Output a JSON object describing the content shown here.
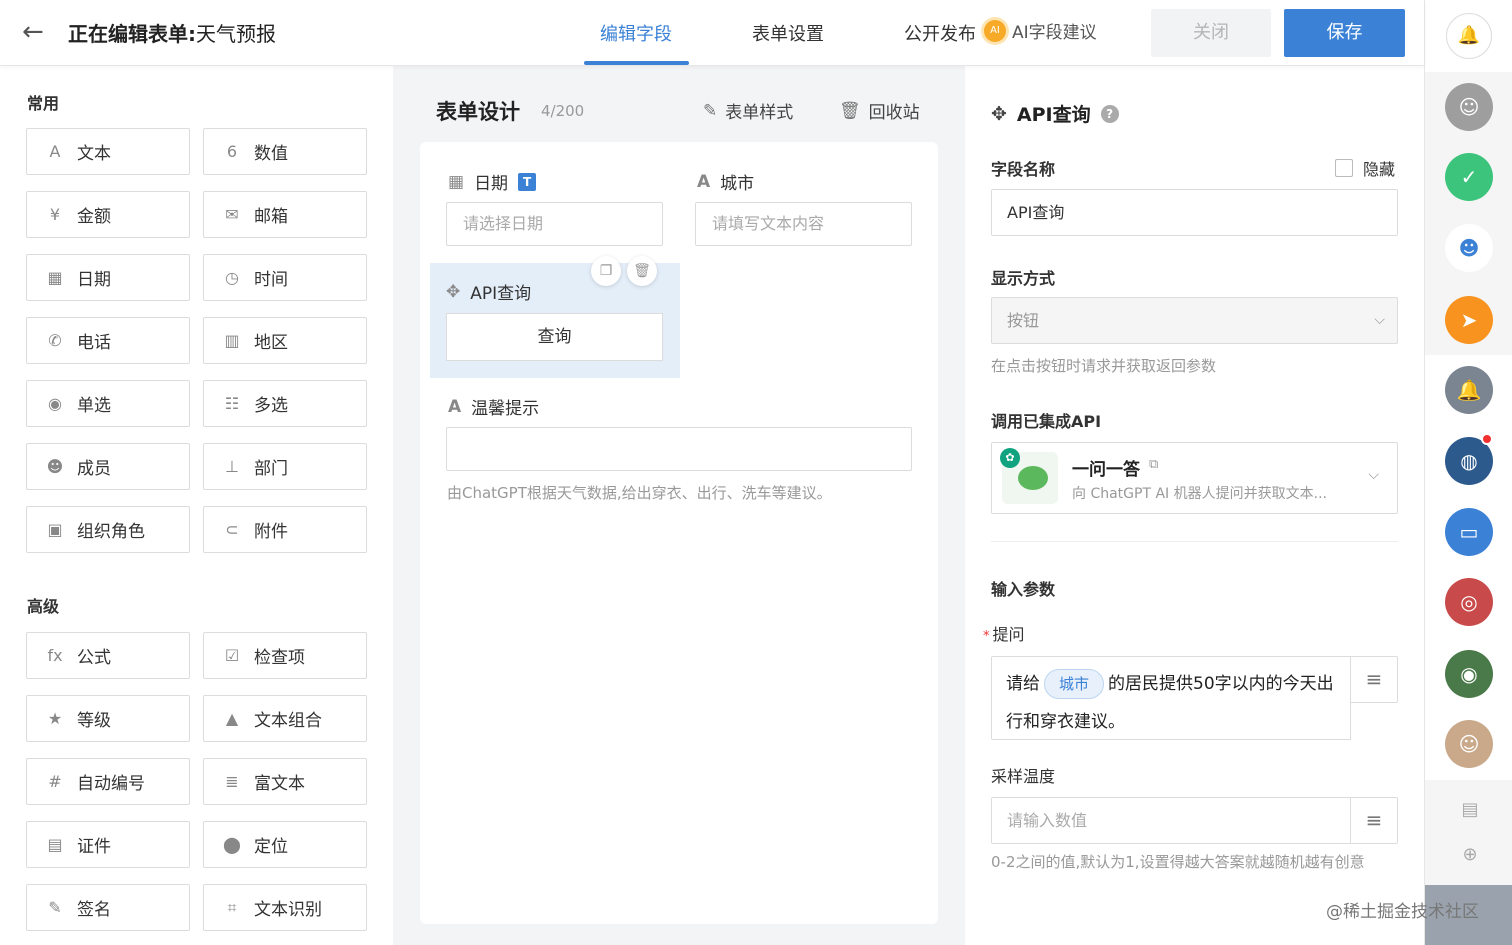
{
  "header": {
    "back_icon": "arrow-left-icon",
    "title_prefix": "正在编辑表单:",
    "title_name": "天气预报",
    "tabs": [
      {
        "label": "编辑字段",
        "active": true
      },
      {
        "label": "表单设置",
        "active": false
      },
      {
        "label": "公开发布",
        "active": false
      }
    ],
    "ai_badge": "AI",
    "ai_suggest": "AI字段建议",
    "close_label": "关闭",
    "save_label": "保存",
    "accent_color": "#3b82d6"
  },
  "palette": {
    "common_title": "常用",
    "common": [
      {
        "label": "文本",
        "icon": "A"
      },
      {
        "label": "数值",
        "icon": "6"
      },
      {
        "label": "金额",
        "icon": "¥"
      },
      {
        "label": "邮箱",
        "icon": "✉"
      },
      {
        "label": "日期",
        "icon": "▦"
      },
      {
        "label": "时间",
        "icon": "◷"
      },
      {
        "label": "电话",
        "icon": "✆"
      },
      {
        "label": "地区",
        "icon": "▥"
      },
      {
        "label": "单选",
        "icon": "◉"
      },
      {
        "label": "多选",
        "icon": "☷"
      },
      {
        "label": "成员",
        "icon": "☻"
      },
      {
        "label": "部门",
        "icon": "⊥"
      },
      {
        "label": "组织角色",
        "icon": "▣"
      },
      {
        "label": "附件",
        "icon": "⊂"
      }
    ],
    "advanced_title": "高级",
    "advanced": [
      {
        "label": "公式",
        "icon": "fx"
      },
      {
        "label": "检查项",
        "icon": "☑"
      },
      {
        "label": "等级",
        "icon": "★"
      },
      {
        "label": "文本组合",
        "icon": "▲"
      },
      {
        "label": "自动编号",
        "icon": "#"
      },
      {
        "label": "富文本",
        "icon": "≣"
      },
      {
        "label": "证件",
        "icon": "▤"
      },
      {
        "label": "定位",
        "icon": "⬤"
      },
      {
        "label": "签名",
        "icon": "✎"
      },
      {
        "label": "文本识别",
        "icon": "⌗"
      }
    ]
  },
  "designer": {
    "title": "表单设计",
    "count": "4/200",
    "style_label": "表单样式",
    "recycle_label": "回收站",
    "date_label": "日期",
    "date_badge": "T",
    "date_placeholder": "请选择日期",
    "city_label": "城市",
    "city_placeholder": "请填写文本内容",
    "api_label": "API查询",
    "query_button": "查询",
    "tip_label": "温馨提示",
    "tip_hint": "由ChatGPT根据天气数据,给出穿衣、出行、洗车等建议。"
  },
  "settings": {
    "title": "API查询",
    "field_name_label": "字段名称",
    "hidden_label": "隐藏",
    "field_name_value": "API查询",
    "display_label": "显示方式",
    "display_value": "按钮",
    "display_hint": "在点击按钮时请求并获取返回参数",
    "api_section_label": "调用已集成API",
    "api_name": "一问一答",
    "api_desc": "向 ChatGPT AI 机器人提问并获取文本...",
    "input_params_label": "输入参数",
    "prompt_label": "提问",
    "prompt_before": "请给",
    "prompt_chip": "城市",
    "prompt_after": "的居民提供50字以内的今天出行和穿衣建议。",
    "temp_label": "采样温度",
    "temp_placeholder": "请输入数值",
    "temp_hint": "0-2之间的值,默认为1,设置得越大答案就越随机越有创意"
  },
  "rail": {
    "icons": [
      {
        "name": "group-avatar-icon",
        "color": "#9e9e9e",
        "glyph": "☺"
      },
      {
        "name": "check-circle-icon",
        "color": "#3cc47c",
        "glyph": "✓"
      },
      {
        "name": "mascot-icon",
        "color": "#ffffff",
        "glyph": "☻"
      },
      {
        "name": "send-icon",
        "color": "#f7931e",
        "glyph": "➤"
      },
      {
        "name": "notification-icon",
        "color": "#7a8591",
        "glyph": "🔔"
      },
      {
        "name": "earth-avatar-icon",
        "color": "#2d5a8c",
        "glyph": "◍"
      },
      {
        "name": "chat-icon",
        "color": "#3b82d6",
        "glyph": "▭"
      },
      {
        "name": "team-photo-icon",
        "color": "#c94a4a",
        "glyph": "◎"
      },
      {
        "name": "photo-avatar-icon",
        "color": "#4a7a4a",
        "glyph": "◉"
      },
      {
        "name": "people-avatar-icon",
        "color": "#c9a98a",
        "glyph": "☺"
      }
    ]
  },
  "watermark": "@稀土掘金技术社区"
}
